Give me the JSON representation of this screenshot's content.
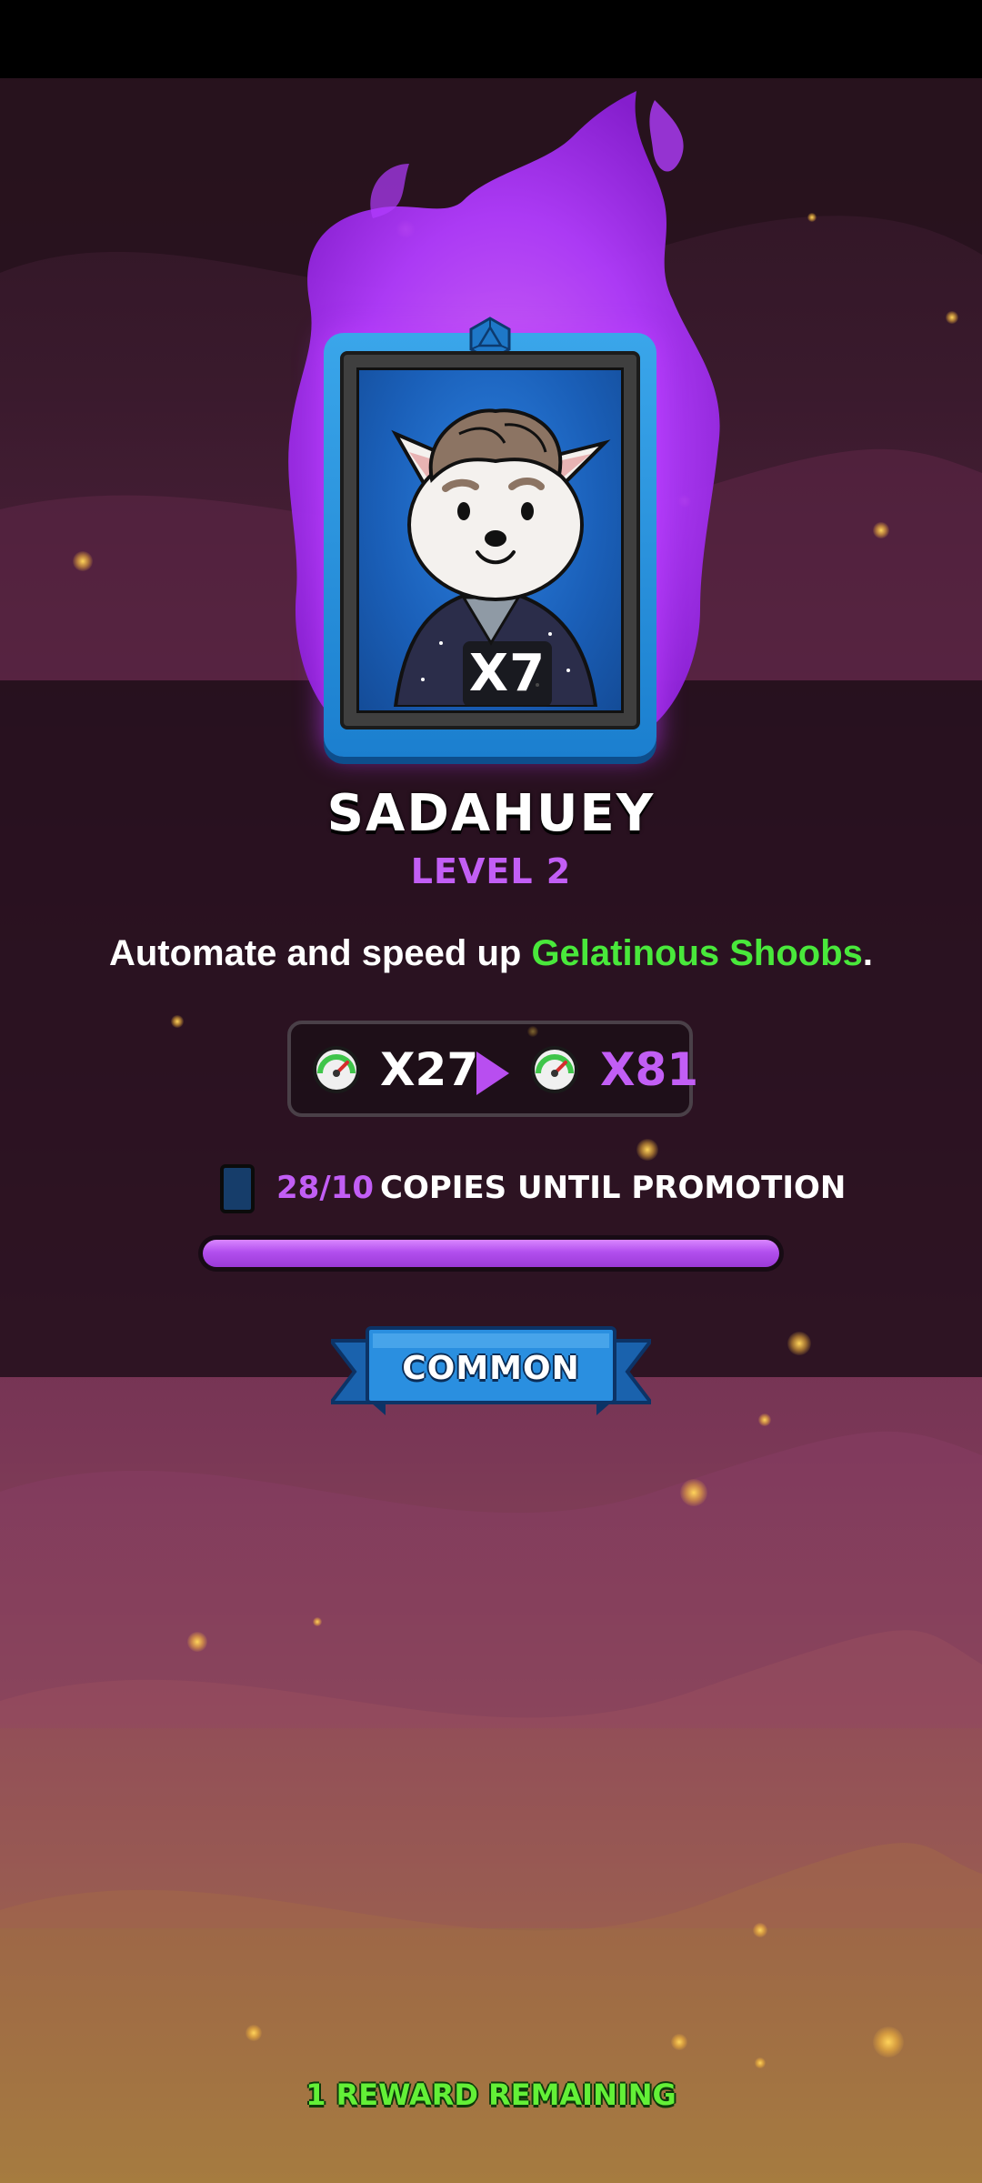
{
  "card": {
    "count_badge": "X7",
    "name": "SADAHUEY",
    "level": "LEVEL 2",
    "rarity": "COMMON",
    "frame_color": "#2a96e3",
    "aura_color": "#b23cff"
  },
  "description": {
    "prefix": "Automate and speed up ",
    "highlight": "Gelatinous Shoobs",
    "suffix": ".",
    "highlight_color": "#49e83b"
  },
  "speed": {
    "current": "X27",
    "next": "X81",
    "icon": "speedometer-icon"
  },
  "promotion": {
    "copies": "28/10",
    "label": "COPIES UNTIL PROMOTION",
    "progress_fraction": 1.0,
    "icon": "card-icon"
  },
  "footer": {
    "rewards_remaining": "1 REWARD REMAINING"
  }
}
